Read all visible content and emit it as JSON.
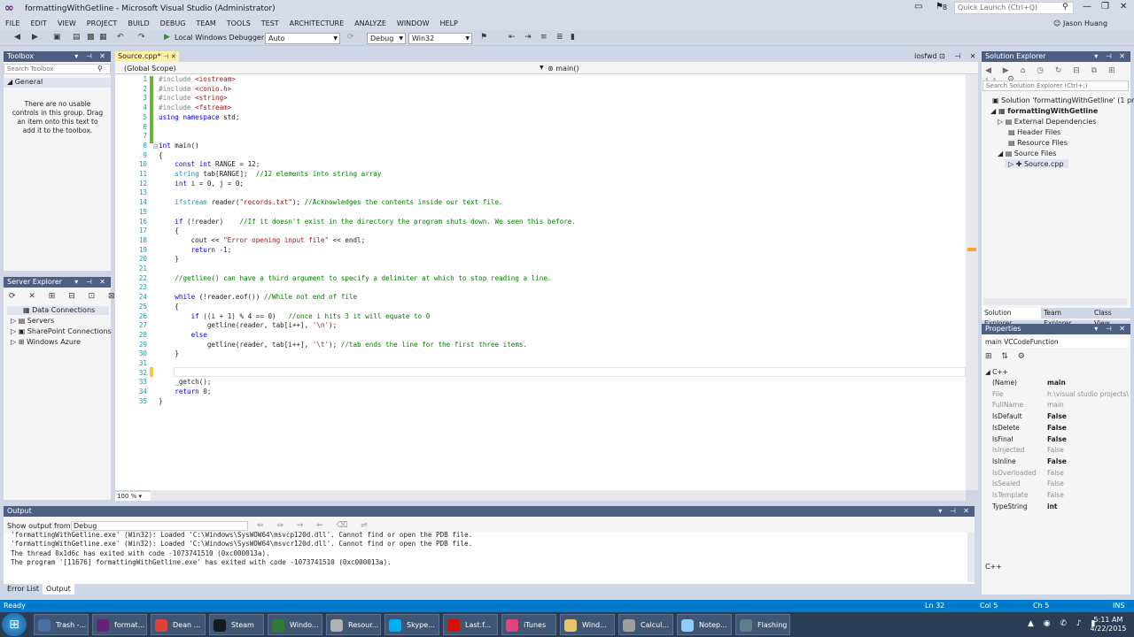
{
  "window": {
    "title": "formattingWithGetline - Microsoft Visual Studio (Administrator)",
    "notifications_count": "8",
    "quick_launch_placeholder": "Quick Launch (Ctrl+Q)",
    "user": "Jason Huang"
  },
  "menu": [
    "FILE",
    "EDIT",
    "VIEW",
    "PROJECT",
    "BUILD",
    "DEBUG",
    "TEAM",
    "TOOLS",
    "TEST",
    "ARCHITECTURE",
    "ANALYZE",
    "WINDOW",
    "HELP"
  ],
  "toolbar": {
    "run_label": "Local Windows Debugger",
    "solution_config_1": "Auto",
    "solution_config_2": "Debug",
    "platform": "Win32"
  },
  "toolbox": {
    "title": "Toolbox",
    "search_placeholder": "Search Toolbox",
    "group": "General",
    "empty_message": "There are no usable controls in this group. Drag an item onto this text to add it to the toolbox."
  },
  "server_explorer": {
    "title": "Server Explorer",
    "items": [
      "Data Connections",
      "Servers",
      "SharePoint Connections",
      "Windows Azure"
    ]
  },
  "editor": {
    "tab": "Source.cpp*",
    "right_tab": "iosfwd",
    "scope": "(Global Scope)",
    "member": "main()",
    "zoom": "100 %",
    "line_numbers": [
      "1",
      "2",
      "3",
      "4",
      "5",
      "6",
      "7",
      "8",
      "9",
      "10",
      "11",
      "12",
      "13",
      "14",
      "15",
      "16",
      "17",
      "18",
      "19",
      "20",
      "21",
      "22",
      "23",
      "24",
      "25",
      "26",
      "27",
      "28",
      "29",
      "30",
      "31",
      "32",
      "33",
      "34",
      "35"
    ],
    "code": [
      "#include <iostream>",
      "#include <conio.h>",
      "#include <string>",
      "#include <fstream>",
      "using namespace std;",
      "",
      "",
      "int main()",
      "{",
      "    const int RANGE = 12;",
      "    string tab[RANGE];  //12 elements into string array",
      "    int i = 0, j = 0;",
      "",
      "    ifstream reader(\"records.txt\"); //Acknowledges the contents inside our text file.",
      "",
      "    if (!reader)    //If it doesn't exist in the directory the program shuts down. We seen this before.",
      "    {",
      "        cout << \"Error opening input file\" << endl;",
      "        return -1;",
      "    }",
      "",
      "    //getline() can have a third argument to specify a delimiter at which to stop reading a line.",
      "",
      "    while (!reader.eof()) //While not end of file",
      "    {",
      "        if ((i + 1) % 4 == 0)   //once i hits 3 it will equate to 0",
      "            getline(reader, tab[i++], '\\n');",
      "        else",
      "            getline(reader, tab[i++], '\\t'); //tab ends the line for the first three items.",
      "    }",
      "",
      "",
      "    _getch();",
      "    return 0;",
      "}"
    ]
  },
  "solution_explorer": {
    "title": "Solution Explorer",
    "search_placeholder": "Search Solution Explorer (Ctrl+;)",
    "items": [
      "Solution 'formattingWithGetline' (1 project)",
      "formattingWithGetline",
      "External Dependencies",
      "Header Files",
      "Resource Files",
      "Source Files",
      "Source.cpp"
    ],
    "tabs": [
      "Solution Explorer",
      "Team Explorer",
      "Class View"
    ]
  },
  "properties": {
    "title": "Properties",
    "object": "main  VCCodeFunction",
    "category": "C++",
    "rows": [
      {
        "name": "(Name)",
        "value": "main"
      },
      {
        "name": "File",
        "value": "h:\\visual studio projects\\"
      },
      {
        "name": "FullName",
        "value": "main"
      },
      {
        "name": "IsDefault",
        "value": "False"
      },
      {
        "name": "IsDelete",
        "value": "False"
      },
      {
        "name": "IsFinal",
        "value": "False"
      },
      {
        "name": "IsInjected",
        "value": "False"
      },
      {
        "name": "IsInline",
        "value": "False"
      },
      {
        "name": "IsOverloaded",
        "value": "False"
      },
      {
        "name": "IsSealed",
        "value": "False"
      },
      {
        "name": "IsTemplate",
        "value": "False"
      },
      {
        "name": "TypeString",
        "value": "int"
      }
    ],
    "description": "C++"
  },
  "output": {
    "title": "Output",
    "show_from_label": "Show output from:",
    "show_from_value": "Debug",
    "lines": [
      "'formattingWithGetline.exe' (Win32): Loaded 'C:\\Windows\\SysWOW64\\msvcp120d.dll'. Cannot find or open the PDB file.",
      "'formattingWithGetline.exe' (Win32): Loaded 'C:\\Windows\\SysWOW64\\msvcr120d.dll'. Cannot find or open the PDB file.",
      "The thread 0x1d6c has exited with code -1073741510 (0xc000013a).",
      "The program '[11676] formattingWithGetline.exe' has exited with code -1073741510 (0xc000013a)."
    ],
    "tabs": [
      "Error List",
      "Output"
    ]
  },
  "status": {
    "left": "Ready",
    "ln": "Ln 32",
    "col": "Col 5",
    "ch": "Ch 5",
    "mode": "INS"
  },
  "taskbar": {
    "tasks": [
      {
        "label": "Trash -...",
        "color": "#4a6fa5"
      },
      {
        "label": "format...",
        "color": "#68217a"
      },
      {
        "label": "Dean ...",
        "color": "#db4437"
      },
      {
        "label": "Steam",
        "color": "#171a21"
      },
      {
        "label": "Windo...",
        "color": "#2e7d32"
      },
      {
        "label": "Resour...",
        "color": "#b0b0b0"
      },
      {
        "label": "Skype...",
        "color": "#00aff0"
      },
      {
        "label": "Last.f...",
        "color": "#d51007"
      },
      {
        "label": "iTunes",
        "color": "#e0447d"
      },
      {
        "label": "Wind...",
        "color": "#e9c46a"
      },
      {
        "label": "Calcul...",
        "color": "#9e9e9e"
      },
      {
        "label": "Notep...",
        "color": "#90caf9"
      },
      {
        "label": "Flashing",
        "color": "#607d8b"
      }
    ],
    "time": "5:11 AM",
    "date": "4/22/2015"
  }
}
